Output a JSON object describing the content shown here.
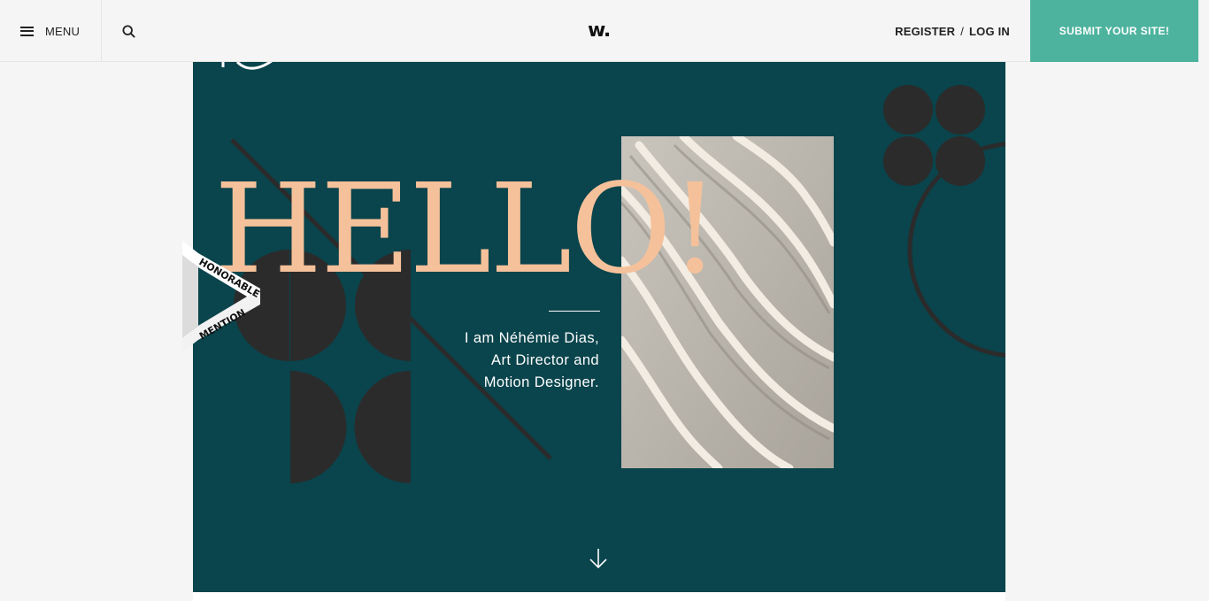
{
  "header": {
    "menu_label": "MENU",
    "logo_text": "w.",
    "register_label": "REGISTER",
    "separator": "/",
    "login_label": "LOG IN",
    "submit_label": "SUBMIT YOUR SITE!"
  },
  "hero": {
    "headline": "HELLO!",
    "intro_lines": [
      "I am Néhémie Dias,",
      "Art Director and",
      "Motion Designer."
    ]
  },
  "badge": {
    "line1": "HONORABLE",
    "line2": "MENTION"
  },
  "icons": {
    "menu": "hamburger-icon",
    "search": "search-icon",
    "scroll": "arrow-down-icon"
  },
  "colors": {
    "accent": "#4db39e",
    "hero_bg": "#0a444c",
    "headline": "#f5c19b",
    "shapes": "#2b2b2b"
  }
}
